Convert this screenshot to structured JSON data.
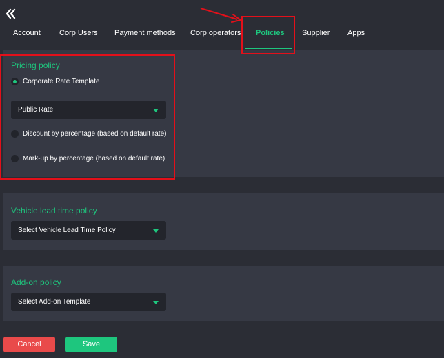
{
  "tabs": [
    {
      "label": "Account"
    },
    {
      "label": "Corp Users"
    },
    {
      "label": "Payment methods"
    },
    {
      "label": "Corp operators"
    },
    {
      "label": "Policies",
      "active": true
    },
    {
      "label": "Supplier"
    },
    {
      "label": "Apps"
    }
  ],
  "pricing_policy": {
    "title": "Pricing policy",
    "options": [
      {
        "label": "Corporate Rate Template",
        "checked": true
      },
      {
        "label": "Discount by percentage (based on default rate)",
        "checked": false
      },
      {
        "label": "Mark-up by percentage (based on default rate)",
        "checked": false
      }
    ],
    "template_select": {
      "value": "Public Rate"
    }
  },
  "vehicle_lead_time_policy": {
    "title": "Vehicle lead time policy",
    "select": {
      "value": "Select Vehicle Lead Time Policy"
    }
  },
  "addon_policy": {
    "title": "Add-on policy",
    "select": {
      "value": "Select Add-on Template"
    }
  },
  "actions": {
    "cancel_label": "Cancel",
    "save_label": "Save"
  },
  "colors": {
    "accent": "#1ec67e",
    "danger": "#e94a4a",
    "background": "#2b2d35",
    "panel": "#363944",
    "input": "#23252c",
    "annotation": "#e3101a"
  },
  "icons": {
    "back": "double-chevron-left-icon",
    "dropdown": "caret-down-icon",
    "annotation_arrow": "arrow-icon"
  }
}
